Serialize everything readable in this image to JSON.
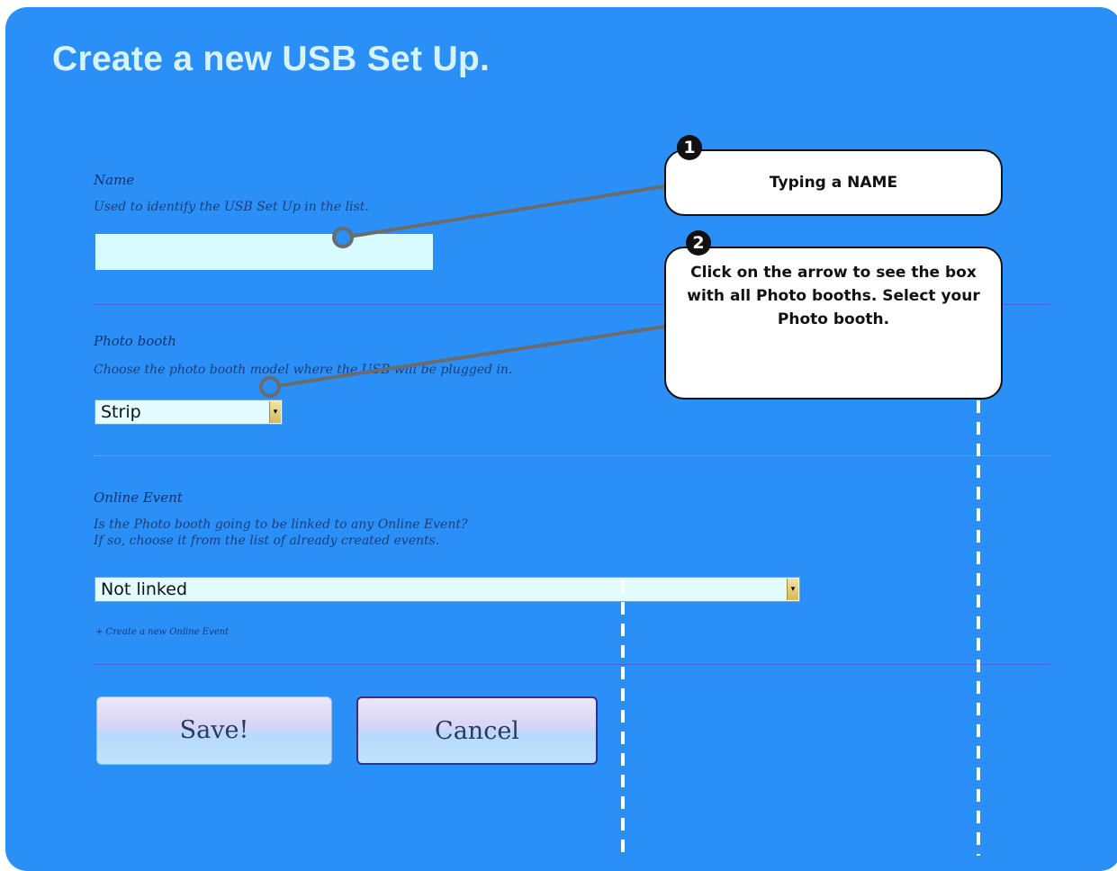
{
  "page": {
    "title": "Create a new USB Set Up."
  },
  "form": {
    "name": {
      "label": "Name",
      "hint": "Used to identify the USB Set Up in the list.",
      "value": ""
    },
    "photo_booth": {
      "label": "Photo booth",
      "hint": "Choose the photo booth model where the USB will be plugged in.",
      "selected": "Strip"
    },
    "online_event": {
      "label": "Online Event",
      "hint_line1": "Is the Photo booth going to be linked to any Online Event?",
      "hint_line2": "If so, choose it from the list of already created events.",
      "selected": "Not linked",
      "create_link": "+ Create a new Online Event"
    },
    "buttons": {
      "save": "Save!",
      "cancel": "Cancel"
    }
  },
  "callouts": [
    {
      "number": "1",
      "text": "Typing a NAME"
    },
    {
      "number": "2",
      "text": "Click on the arrow to see the box with all Photo booths. Select your Photo booth."
    }
  ],
  "icons": {
    "select_arrow": "dropdown-arrow-icon"
  },
  "colors": {
    "panel": "#2a8ff6",
    "title": "#d6f2fb",
    "input_bg": "#d8fbff"
  }
}
